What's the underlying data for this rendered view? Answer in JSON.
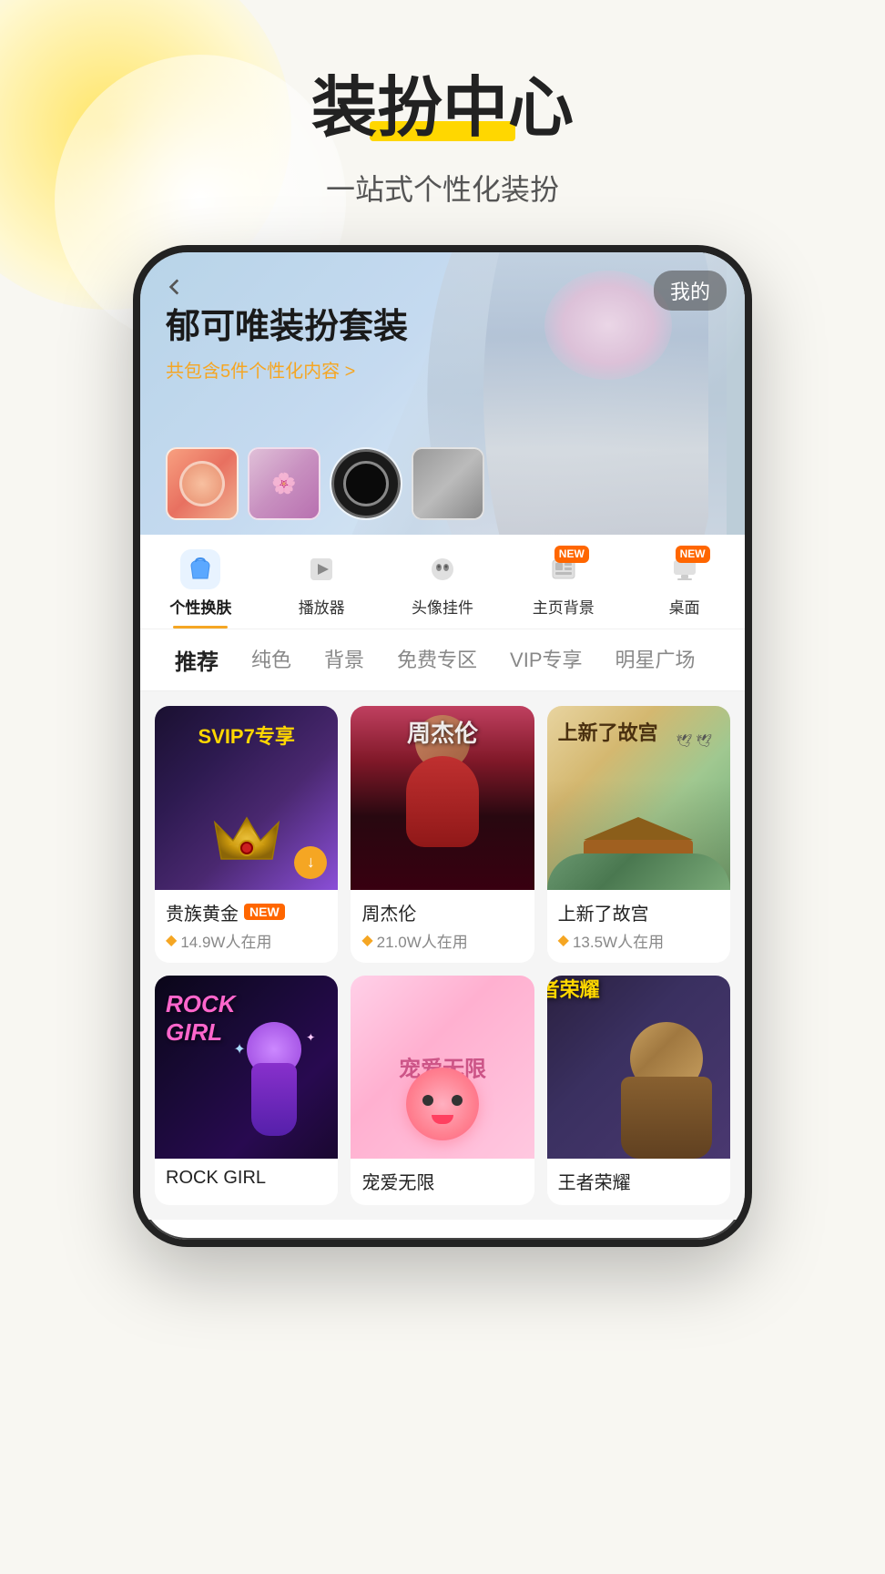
{
  "header": {
    "main_title": "装扮中心",
    "subtitle": "一站式个性化装扮",
    "title_highlight_color": "#FFD700"
  },
  "banner": {
    "back_icon": "‹",
    "my_label": "我的",
    "title": "郁可唯装扮套装",
    "subtitle": "共包含5件个性化内容 >",
    "subtitle_arrow": ">"
  },
  "category_tabs": [
    {
      "id": "skin",
      "label": "个性换肤",
      "icon": "shirt",
      "active": true,
      "has_new": false
    },
    {
      "id": "player",
      "label": "播放器",
      "icon": "play",
      "active": false,
      "has_new": false
    },
    {
      "id": "avatar",
      "label": "头像挂件",
      "icon": "mickey",
      "active": false,
      "has_new": false
    },
    {
      "id": "home_bg",
      "label": "主页背景",
      "icon": "grid",
      "active": false,
      "has_new": true
    },
    {
      "id": "desktop",
      "label": "桌面",
      "icon": "desktop",
      "active": false,
      "has_new": true
    }
  ],
  "sub_tabs": [
    {
      "id": "recommend",
      "label": "推荐",
      "active": true
    },
    {
      "id": "solid",
      "label": "纯色",
      "active": false
    },
    {
      "id": "bg",
      "label": "背景",
      "active": false
    },
    {
      "id": "free",
      "label": "免费专区",
      "active": false
    },
    {
      "id": "vip",
      "label": "VIP专享",
      "active": false
    },
    {
      "id": "star",
      "label": "明星广场",
      "active": false
    }
  ],
  "grid_items": [
    {
      "id": "item1",
      "name": "贵族黄金",
      "has_new": true,
      "users": "14.9W人在用",
      "diamond_color": "gold",
      "label_overlay": "SVIP7专享",
      "type": "svip"
    },
    {
      "id": "item2",
      "name": "周杰伦",
      "has_new": false,
      "users": "21.0W人在用",
      "diamond_color": "gold",
      "type": "star"
    },
    {
      "id": "item3",
      "name": "上新了故宫",
      "has_new": false,
      "users": "13.5W人在用",
      "diamond_color": "gold",
      "type": "palace"
    },
    {
      "id": "item4",
      "name": "ROCK GIRL",
      "has_new": false,
      "users": "",
      "diamond_color": "none",
      "type": "rock"
    },
    {
      "id": "item5",
      "name": "宠爱无限",
      "has_new": false,
      "users": "",
      "diamond_color": "none",
      "type": "pet"
    },
    {
      "id": "item6",
      "name": "王者荣耀",
      "has_new": false,
      "users": "",
      "diamond_color": "none",
      "type": "king"
    }
  ],
  "new_badge_text": "NEW",
  "download_icon": "↓"
}
